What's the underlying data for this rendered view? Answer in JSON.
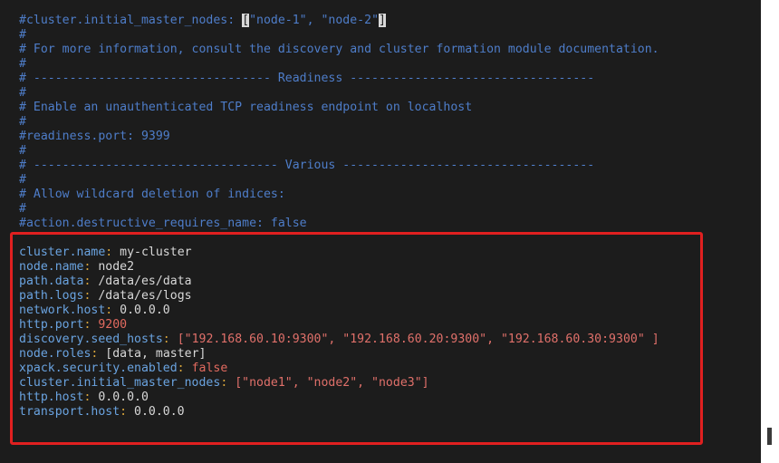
{
  "editor": {
    "comments": [
      {
        "pre": "#cluster.initial_master_nodes: ",
        "bracket_open": "[",
        "middle": "\"node-1\", \"node-2\"",
        "bracket_close": "]"
      },
      "#",
      "# For more information, consult the discovery and cluster formation module documentation.",
      "#",
      "# --------------------------------- Readiness ----------------------------------",
      "#",
      "# Enable an unauthenticated TCP readiness endpoint on localhost",
      "#",
      "#readiness.port: 9399",
      "#",
      "# ---------------------------------- Various -----------------------------------",
      "#",
      "# Allow wildcard deletion of indices:",
      "#",
      "#action.destructive_requires_name: false"
    ],
    "config": [
      {
        "key": "cluster.name",
        "sep": ": ",
        "value": "my-cluster"
      },
      {
        "key": "node.name",
        "sep": ": ",
        "value": "node2"
      },
      {
        "key": "path.data",
        "sep": ": ",
        "value": "/data/es/data"
      },
      {
        "key": "path.logs",
        "sep": ": ",
        "value": "/data/es/logs"
      },
      {
        "key": "network.host",
        "sep": ": ",
        "value": "0.0.0.0"
      },
      {
        "key": "http.port",
        "sep": ": ",
        "value": "9200"
      },
      {
        "key": "discovery.seed_hosts",
        "sep": ": ",
        "value": "[\"192.168.60.10:9300\", \"192.168.60.20:9300\", \"192.168.60.30:9300\" ]"
      },
      {
        "key": "node.roles",
        "sep": ": ",
        "value": "[data, master]"
      },
      {
        "key": "xpack.security.enabled",
        "sep": ": ",
        "value": "false"
      },
      {
        "key": "cluster.initial_master_nodes",
        "sep": ": ",
        "value": "[\"node1\", \"node2\", \"node3\"]"
      },
      {
        "key": "http.host",
        "sep": ": ",
        "value": "0.0.0.0"
      },
      {
        "key": "transport.host",
        "sep": ": ",
        "value": "0.0.0.0"
      }
    ]
  },
  "colors": {
    "background": "#1c1c1c",
    "comment": "#4e7dc9",
    "highlight_border": "#e02020"
  }
}
